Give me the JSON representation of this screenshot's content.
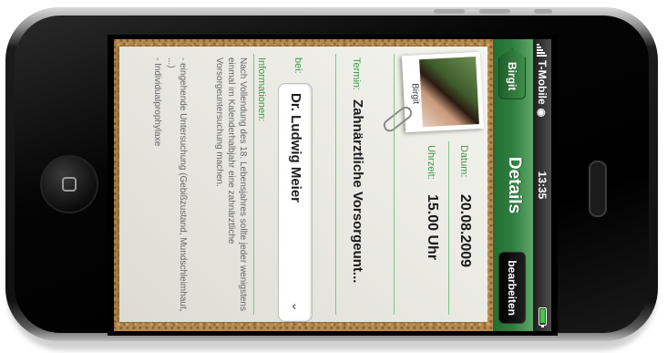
{
  "status_bar": {
    "carrier": "T-Mobile",
    "time": "13:35"
  },
  "nav": {
    "back_label": "Birgit",
    "title": "Details",
    "edit_label": "bearbeiten"
  },
  "photo": {
    "caption": "Birgit"
  },
  "fields": {
    "date_label": "Datum:",
    "date_value": "20.08.2009",
    "time_label": "Uhrzeit:",
    "time_value": "15.00 Uhr",
    "appointment_label": "Termin:",
    "appointment_value": "Zahnärztliche Vorsorgeunt...",
    "with_label": "bei:",
    "with_value": "Dr. Ludwig Meier",
    "info_label": "Informationen:"
  },
  "info": {
    "text": "Nach Vollendung des 18. Lebensjahres sollte jeder wenigstens einmal im Kalenderhalbjahr eine zahnärztliche Vorsorgeuntersuchung machen.",
    "bullets": [
      "- eingehende Untersuchung (Gebißzustand, Mundschleimhaut, ...)",
      "- Individualprophylaxe"
    ]
  },
  "colors": {
    "accent_green": "#2f7f3f",
    "label_green": "#3d9a4c",
    "cork": "#b88a4e"
  },
  "icons": [
    "signal-icon",
    "wifi-icon",
    "battery-icon",
    "chevron-down-icon",
    "paperclip-icon",
    "home-button-icon"
  ]
}
